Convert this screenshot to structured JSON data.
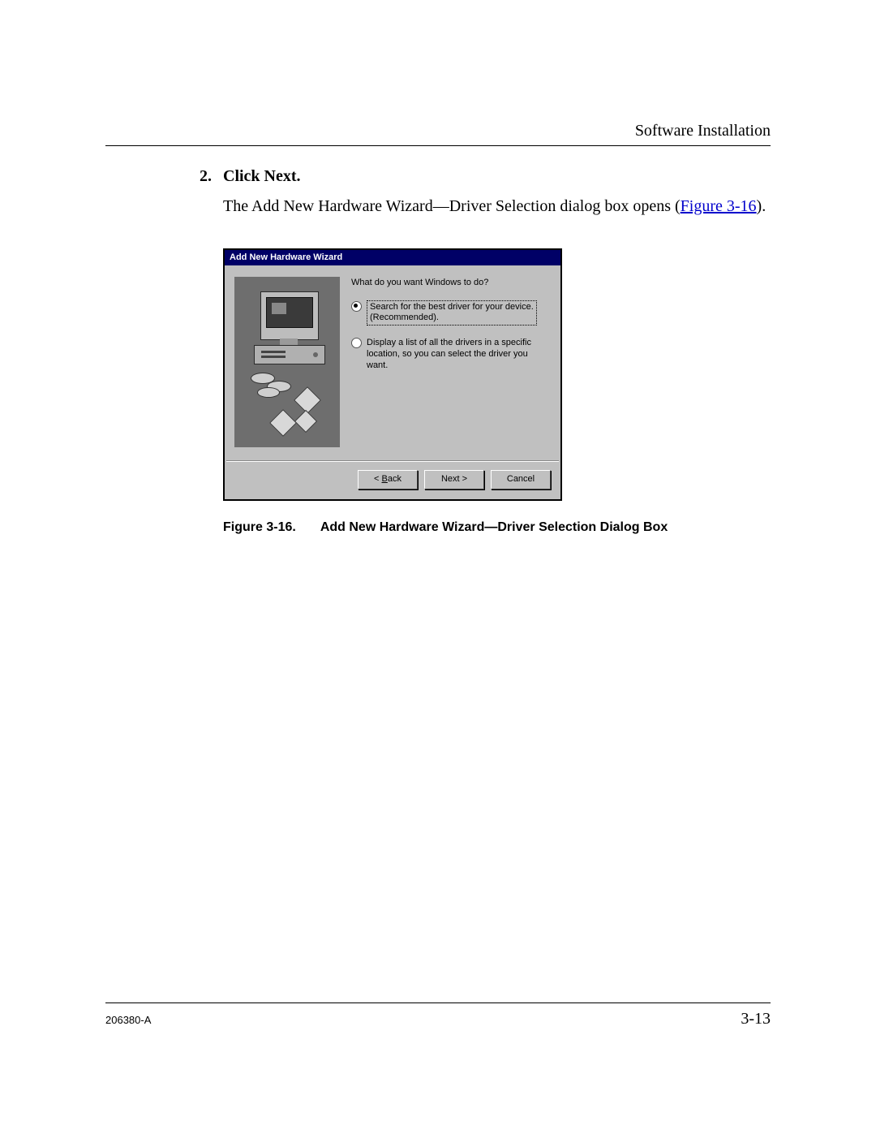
{
  "header": {
    "section_title": "Software Installation"
  },
  "step": {
    "number": "2.",
    "heading": "Click Next.",
    "body_prefix": "The Add New Hardware Wizard—Driver Selection dialog box opens (",
    "figure_link": "Figure 3-16",
    "body_suffix": ")."
  },
  "dialog": {
    "title": "Add New Hardware Wizard",
    "prompt": "What do you want Windows to do?",
    "option1_line1": "Search for the best driver for your device.",
    "option1_line2": "(Recommended).",
    "option2_line1": "Display a list of all the drivers in a specific",
    "option2_line2": "location, so you can select the driver you want.",
    "buttons": {
      "back_prefix": "< ",
      "back_u": "B",
      "back_rest": "ack",
      "next": "Next >",
      "cancel": "Cancel"
    }
  },
  "caption": {
    "label": "Figure 3-16.",
    "text": "Add New Hardware Wizard—Driver Selection Dialog Box"
  },
  "footer": {
    "doc_id": "206380-A",
    "page": "3-13"
  }
}
